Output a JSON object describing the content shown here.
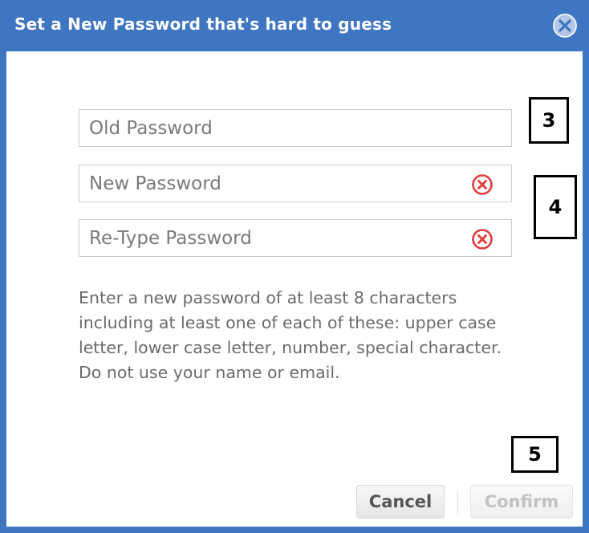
{
  "dialog": {
    "title": "Set a New Password that's hard to guess",
    "close_icon": "close-circle-icon"
  },
  "fields": {
    "old_password": {
      "placeholder": "Old Password",
      "value": ""
    },
    "new_password": {
      "placeholder": "New Password",
      "value": "",
      "status_icon": "error-circle-x-icon"
    },
    "retype_password": {
      "placeholder": "Re-Type Password",
      "value": "",
      "status_icon": "error-circle-x-icon"
    }
  },
  "annotations": {
    "a3": "3",
    "a4": "4",
    "a5": "5"
  },
  "help_text": "Enter a new password of at least 8 characters including at least one of each of these: upper case letter, lower case letter, number, special character. Do not use your name or email.",
  "buttons": {
    "cancel_label": "Cancel",
    "confirm_label": "Confirm",
    "confirm_disabled": true
  },
  "colors": {
    "titlebar": "#3f76c2",
    "error_icon": "#e03a3a",
    "text_muted": "#6b6b6b"
  }
}
